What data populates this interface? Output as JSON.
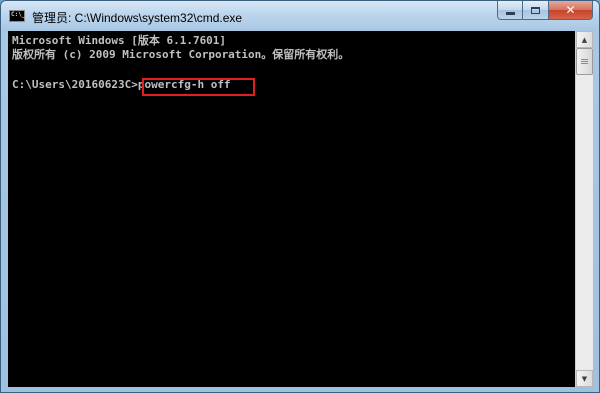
{
  "window": {
    "title": "管理员: C:\\Windows\\system32\\cmd.exe",
    "icon": "cmd-icon",
    "icon_text": "C:\\_",
    "controls": {
      "minimize": "minimize-icon",
      "maximize": "maximize-icon",
      "close": "close-icon",
      "close_glyph": "✕"
    }
  },
  "console": {
    "lines": [
      "Microsoft Windows [版本 6.1.7601]",
      "版权所有 (c) 2009 Microsoft Corporation。保留所有权利。",
      ""
    ],
    "prompt": "C:\\Users\\20160623C>",
    "command": "powercfg-h off"
  },
  "scrollbar": {
    "up_arrow": "▲",
    "down_arrow": "▼"
  },
  "colors": {
    "console_bg": "#000000",
    "console_text": "#c0c0c0",
    "highlight_border": "#e02020"
  }
}
